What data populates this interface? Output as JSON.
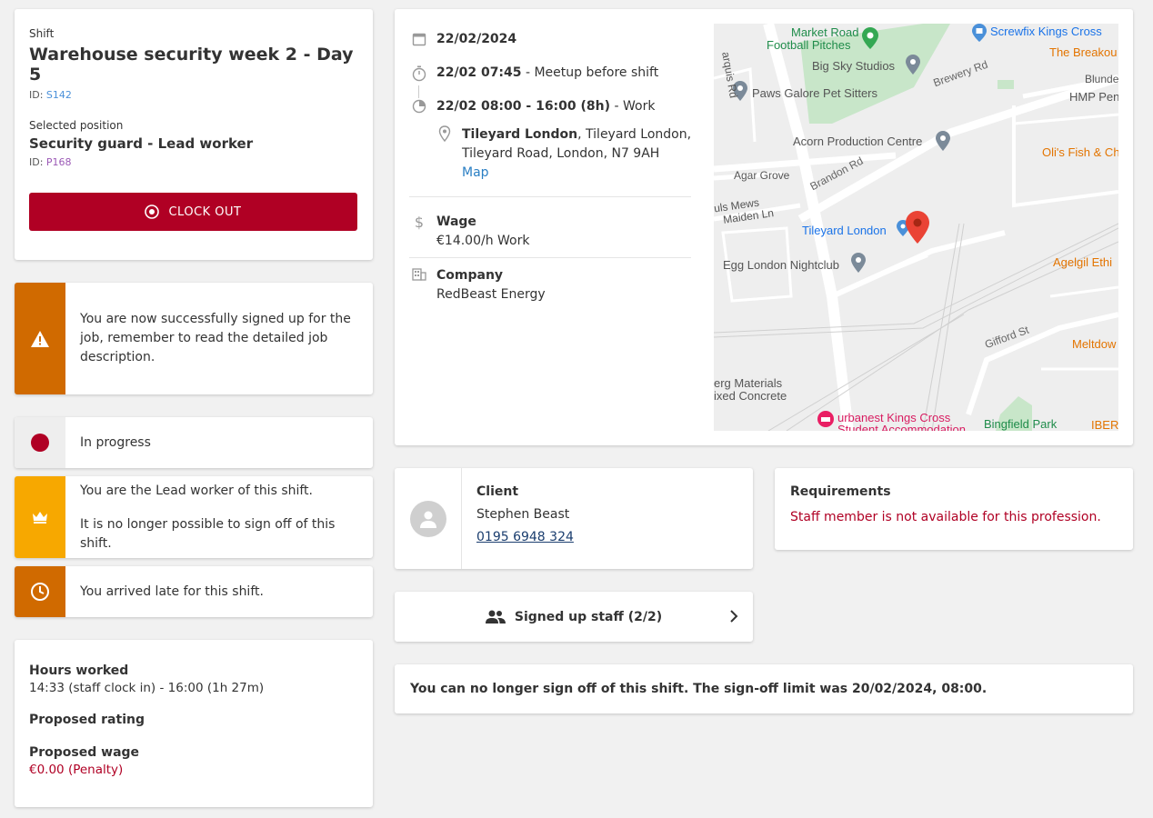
{
  "shift": {
    "label": "Shift",
    "title": "Warehouse security week 2 - Day 5",
    "id_prefix": "ID: ",
    "id": "S142",
    "position_label": "Selected position",
    "position_title": "Security guard - Lead worker",
    "position_id": "P168",
    "clock_out_label": "CLOCK OUT"
  },
  "alerts": {
    "signed_up": "You are now successfully signed up for the job, remember to read the detailed job description.",
    "status": "In progress",
    "lead_line1": "You are the Lead worker of this shift.",
    "lead_line2": "It is no longer possible to sign off of this shift.",
    "late": "You arrived late for this shift."
  },
  "hours": {
    "hours_label": "Hours worked",
    "hours_value": "14:33 (staff clock in) - 16:00 (1h 27m)",
    "rating_label": "Proposed rating",
    "wage_label": "Proposed wage",
    "wage_value": "€0.00 (Penalty)"
  },
  "details": {
    "date": "22/02/2024",
    "meetup_time": "22/02 07:45",
    "meetup_text": " - Meetup before shift",
    "work_time": "22/02 08:00 - 16:00 (8h)",
    "work_text": " - Work",
    "location_name": "Tileyard London",
    "location_rest": ", Tileyard London,",
    "location_line2": "Tileyard Road, London, N7 9AH",
    "map_link": "Map",
    "wage_label": "Wage",
    "wage_value": "€14.00/h Work",
    "company_label": "Company",
    "company_value": "RedBeast Energy"
  },
  "map_labels": {
    "market_road": "Market Road",
    "football": "Football Pitches",
    "screwfix": "Screwfix Kings Cross",
    "breakout": "The Breakou",
    "big_sky": "Big Sky Studios",
    "brewery": "Brewery Rd",
    "blunde": "Blunde",
    "hmp": "HMP Pen",
    "paws": "Paws Galore Pet Sitters",
    "acorn": "Acorn Production Centre",
    "olis": "Oli's Fish & Ch",
    "agar": "Agar Grove",
    "brandon": "Brandon Rd",
    "mews": "uls Mews",
    "maiden": "Maiden Ln",
    "tileyard": "Tileyard London",
    "egg": "Egg London Nightclub",
    "agelgil": "Agelgil Ethi",
    "gifford": "Gifford St",
    "meltdown": "Meltdow",
    "materials1": "erg Materials",
    "materials2": "ixed Concrete",
    "urbanest1": "urbanest Kings Cross",
    "urbanest2": "Student Accommodation",
    "bingfield": "Bingfield Park",
    "iber": "IBER",
    "arquis": "arquis Rd"
  },
  "client": {
    "label": "Client",
    "name": "Stephen Beast",
    "phone": "0195 6948 324"
  },
  "requirements": {
    "label": "Requirements",
    "value": "Staff member is not available for this profession."
  },
  "staff": {
    "label": "Signed up staff (2/2)"
  },
  "signoff": {
    "text": "You can no longer sign off of this shift. The sign-off limit was 20/02/2024, 08:00."
  },
  "colors": {
    "primary_red": "#b00024",
    "warning_orange": "#d06a00",
    "lead_yellow": "#f7a800",
    "link_blue": "#2a7fc4"
  }
}
